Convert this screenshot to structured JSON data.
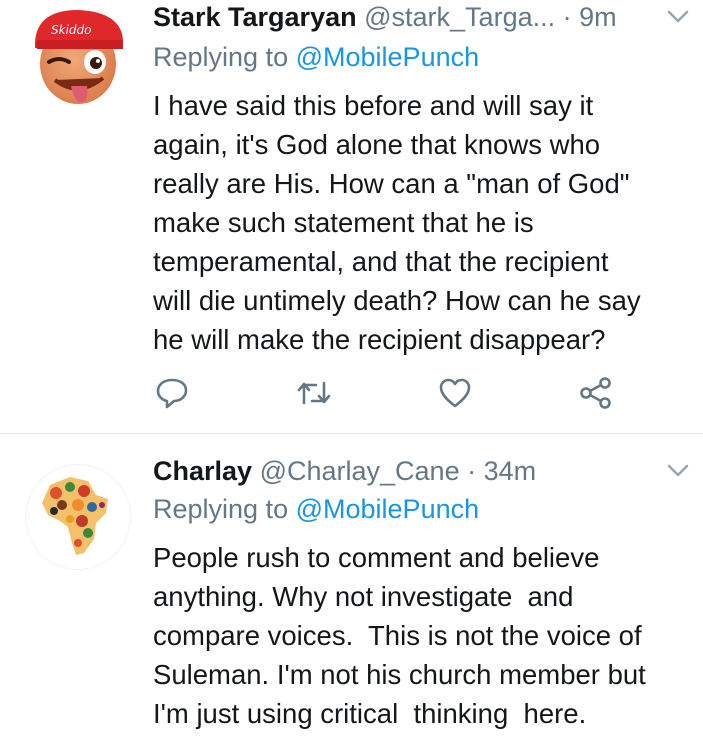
{
  "tweets": [
    {
      "name": "Stark Targaryan",
      "handle": "@stark_Targa...",
      "separator": "·",
      "time": "9m",
      "replying_prefix": "Replying to",
      "replying_to": "@MobilePunch",
      "text": "I have said this before and will say it\nagain, it's God alone that knows who\nreally are His. How can a \"man of God\"\nmake such statement that he is\ntemperamental, and that the recipient\nwill die untimely death? How can he say\nhe will make the recipient disappear?",
      "avatar_badge": "Skiddo",
      "actions": [
        "reply-icon",
        "retweet-icon",
        "like-icon",
        "share-icon"
      ]
    },
    {
      "name": "Charlay",
      "handle": "@Charlay_Cane",
      "separator": "·",
      "time": "34m",
      "replying_prefix": "Replying to",
      "replying_to": "@MobilePunch",
      "text": "People rush to comment and believe\nanything. Why not investigate  and\ncompare voices.  This is not the voice of\nSuleman. I'm not his church member but\nI'm just using critical  thinking  here."
    }
  ],
  "colors": {
    "text": "#14171a",
    "secondary": "#657786",
    "link": "#1b95e0",
    "divider": "#e1e8ed",
    "icon": "#657786"
  }
}
